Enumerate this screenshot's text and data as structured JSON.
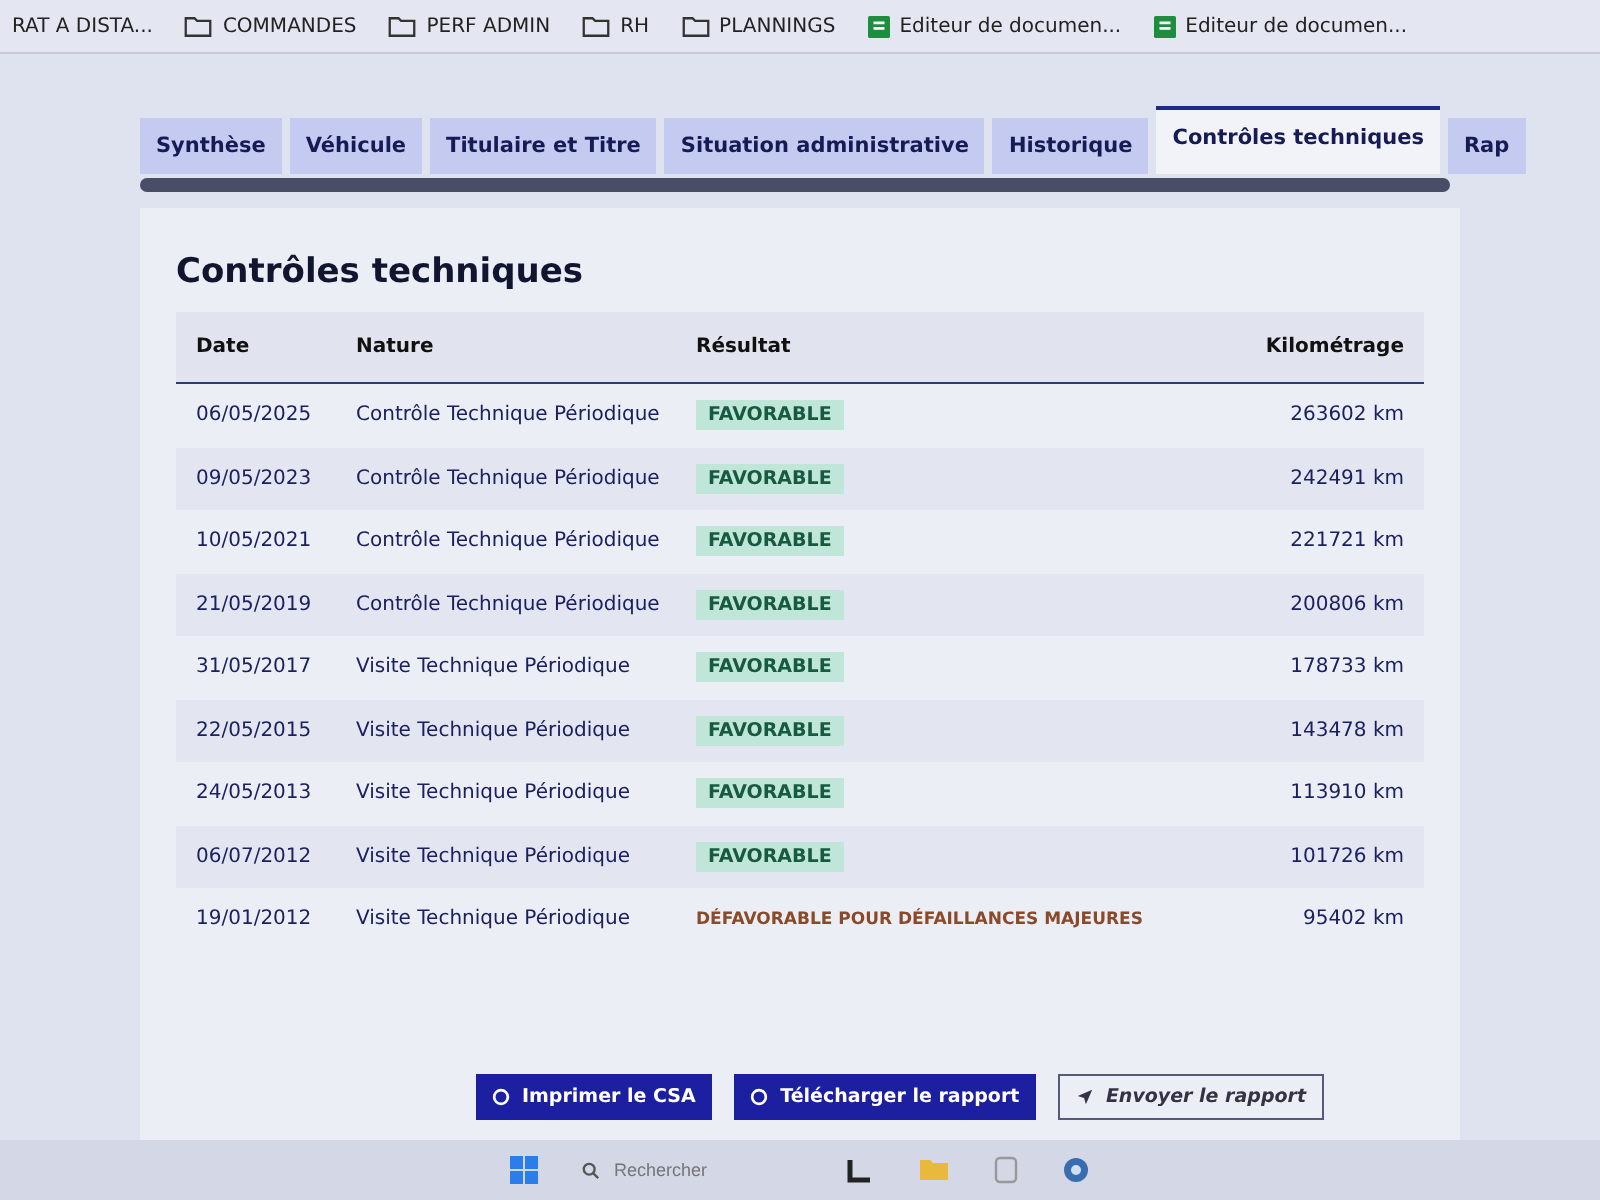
{
  "bookmarks": [
    {
      "label": "RAT A DISTA...",
      "kind": "plain"
    },
    {
      "label": "COMMANDES",
      "kind": "folder"
    },
    {
      "label": "PERF ADMIN",
      "kind": "folder"
    },
    {
      "label": "RH",
      "kind": "folder"
    },
    {
      "label": "PLANNINGS",
      "kind": "folder"
    },
    {
      "label": "Editeur de documen...",
      "kind": "doc"
    },
    {
      "label": "Editeur de documen...",
      "kind": "doc"
    }
  ],
  "tabs": [
    {
      "label": "Synthèse",
      "selected": false
    },
    {
      "label": "Véhicule",
      "selected": false
    },
    {
      "label": "Titulaire et Titre",
      "selected": false
    },
    {
      "label": "Situation administrative",
      "selected": false
    },
    {
      "label": "Historique",
      "selected": false
    },
    {
      "label": "Contrôles techniques",
      "selected": true
    },
    {
      "label": "Rap",
      "selected": false
    }
  ],
  "section": {
    "title": "Contrôles techniques"
  },
  "table": {
    "columns": [
      "Date",
      "Nature",
      "Résultat",
      "Kilométrage"
    ],
    "rows": [
      {
        "date": "06/05/2025",
        "nature": "Contrôle Technique Périodique",
        "result": "FAVORABLE",
        "kind": "favorable",
        "km": "263602 km"
      },
      {
        "date": "09/05/2023",
        "nature": "Contrôle Technique Périodique",
        "result": "FAVORABLE",
        "kind": "favorable",
        "km": "242491 km"
      },
      {
        "date": "10/05/2021",
        "nature": "Contrôle Technique Périodique",
        "result": "FAVORABLE",
        "kind": "favorable",
        "km": "221721 km"
      },
      {
        "date": "21/05/2019",
        "nature": "Contrôle Technique Périodique",
        "result": "FAVORABLE",
        "kind": "favorable",
        "km": "200806 km"
      },
      {
        "date": "31/05/2017",
        "nature": "Visite Technique Périodique",
        "result": "FAVORABLE",
        "kind": "favorable",
        "km": "178733 km"
      },
      {
        "date": "22/05/2015",
        "nature": "Visite Technique Périodique",
        "result": "FAVORABLE",
        "kind": "favorable",
        "km": "143478 km"
      },
      {
        "date": "24/05/2013",
        "nature": "Visite Technique Périodique",
        "result": "FAVORABLE",
        "kind": "favorable",
        "km": "113910 km"
      },
      {
        "date": "06/07/2012",
        "nature": "Visite Technique Périodique",
        "result": "FAVORABLE",
        "kind": "favorable",
        "km": "101726 km"
      },
      {
        "date": "19/01/2012",
        "nature": "Visite Technique Périodique",
        "result": "DÉFAVORABLE POUR DÉFAILLANCES MAJEURES",
        "kind": "defavorable",
        "km": "95402 km"
      }
    ]
  },
  "buttons": [
    {
      "label": "Imprimer le CSA",
      "kind": "primary"
    },
    {
      "label": "Télécharger le rapport",
      "kind": "primary"
    },
    {
      "label": "Envoyer le rapport",
      "kind": "outline"
    }
  ],
  "taskbar": {
    "search_placeholder": "Rechercher"
  }
}
